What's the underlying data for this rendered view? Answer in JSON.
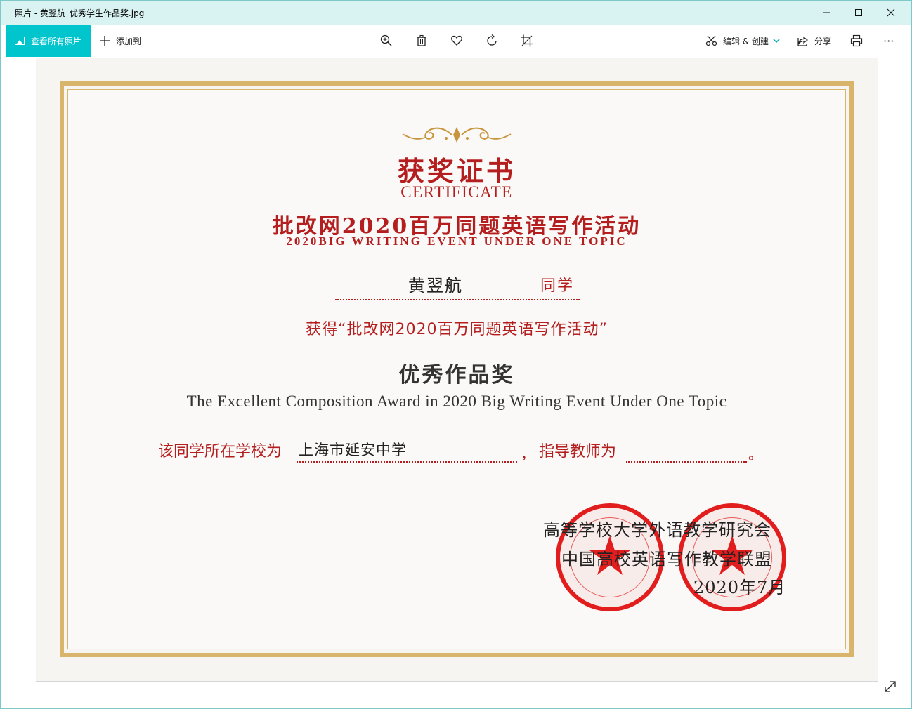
{
  "window": {
    "title": "照片 - 黄翌航_优秀学生作品奖.jpg",
    "minimize": "—",
    "maximize": "☐",
    "close": "✕"
  },
  "toolbar": {
    "view_all": "查看所有照片",
    "add_to": "添加到",
    "edit_create": "编辑 & 创建",
    "share": "分享",
    "more": "···"
  },
  "certificate": {
    "title_cn": "获奖证书",
    "title_en": "CERTIFICATE",
    "event_cn": "批改网2020百万同题英语写作活动",
    "event_en": "2020BIG WRITING EVENT UNDER ONE TOPIC",
    "student_name": "黄翌航",
    "classmate": "同学",
    "award_line": "获得“批改网2020百万同题英语写作活动”",
    "award_cn": "优秀作品奖",
    "award_en": "The Excellent Composition Award in 2020 Big Writing Event Under One Topic",
    "school_label": "该同学所在学校为",
    "school": "上海市延安中学",
    "comma": "，",
    "teacher_label": "指导教师为",
    "period": "。",
    "org1": "高等学校大学外语教学研究会",
    "org2": "中国高校英语写作教学联盟",
    "date": "2020年7月"
  },
  "colors": {
    "accent": "#00c5cd",
    "title_red": "#b41e1e",
    "seal_red": "#e21d1d",
    "frame_gold": "#d8b56a"
  }
}
